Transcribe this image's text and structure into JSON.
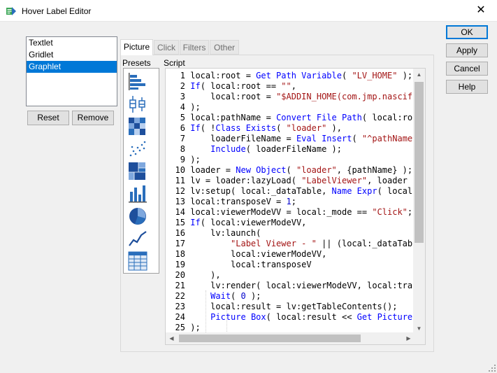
{
  "window": {
    "title": "Hover Label Editor"
  },
  "list": {
    "items": [
      {
        "label": "Textlet",
        "selected": false
      },
      {
        "label": "Gridlet",
        "selected": false
      },
      {
        "label": "Graphlet",
        "selected": true
      }
    ]
  },
  "buttons": {
    "reset": "Reset",
    "remove": "Remove",
    "ok": "OK",
    "apply": "Apply",
    "cancel": "Cancel",
    "help": "Help"
  },
  "tabs": [
    "Picture",
    "Click",
    "Filters",
    "Other"
  ],
  "labels": {
    "presets": "Presets",
    "script": "Script"
  },
  "presets": [
    "horizontal-bar-chart-icon",
    "box-plot-icon",
    "heat-map-icon",
    "scatter-plot-icon",
    "treemap-icon",
    "bar-chart-icon",
    "pie-chart-icon",
    "line-chart-icon",
    "table-icon"
  ],
  "colors": {
    "selection": "#0078d7",
    "keyword": "#0000ff",
    "string": "#a31515",
    "icon_blue": "#2a6ebb"
  },
  "script": {
    "lines": [
      {
        "n": "1",
        "parts": [
          {
            "t": "local:root = ",
            "c": "code"
          },
          {
            "t": "Get Path Variable",
            "c": "kw"
          },
          {
            "t": "( ",
            "c": "code"
          },
          {
            "t": "\"LV_HOME\"",
            "c": "str"
          },
          {
            "t": " );",
            "c": "code"
          }
        ]
      },
      {
        "n": "2",
        "parts": [
          {
            "t": "If",
            "c": "kw"
          },
          {
            "t": "( local:root == ",
            "c": "code"
          },
          {
            "t": "\"\"",
            "c": "str"
          },
          {
            "t": ",",
            "c": "code"
          }
        ]
      },
      {
        "n": "3",
        "parts": [
          {
            "t": "    local:root = ",
            "c": "code"
          },
          {
            "t": "\"$ADDIN_HOME(com.jmp.nascif",
            "c": "str"
          }
        ]
      },
      {
        "n": "4",
        "parts": [
          {
            "t": ");",
            "c": "code"
          }
        ]
      },
      {
        "n": "5",
        "parts": [
          {
            "t": "local:pathName = ",
            "c": "code"
          },
          {
            "t": "Convert File Path",
            "c": "kw"
          },
          {
            "t": "( local:roo",
            "c": "code"
          }
        ]
      },
      {
        "n": "6",
        "parts": [
          {
            "t": "If",
            "c": "kw"
          },
          {
            "t": "( !",
            "c": "code"
          },
          {
            "t": "Class Exists",
            "c": "kw"
          },
          {
            "t": "( ",
            "c": "code"
          },
          {
            "t": "\"loader\"",
            "c": "str"
          },
          {
            "t": " ),",
            "c": "code"
          }
        ]
      },
      {
        "n": "7",
        "parts": [
          {
            "t": "    loaderFileName = ",
            "c": "code"
          },
          {
            "t": "Eval Insert",
            "c": "kw"
          },
          {
            "t": "( ",
            "c": "code"
          },
          {
            "t": "\"^pathName^",
            "c": "str"
          }
        ]
      },
      {
        "n": "8",
        "parts": [
          {
            "t": "    ",
            "c": "code"
          },
          {
            "t": "Include",
            "c": "kw"
          },
          {
            "t": "( loaderFileName );",
            "c": "code"
          }
        ]
      },
      {
        "n": "9",
        "parts": [
          {
            "t": ");",
            "c": "code"
          }
        ]
      },
      {
        "n": "10",
        "parts": [
          {
            "t": "loader = ",
            "c": "code"
          },
          {
            "t": "New Object",
            "c": "kw"
          },
          {
            "t": "( ",
            "c": "code"
          },
          {
            "t": "\"loader\"",
            "c": "str"
          },
          {
            "t": ", {pathName} );",
            "c": "code"
          }
        ]
      },
      {
        "n": "11",
        "parts": [
          {
            "t": "lv = loader:lazyLoad( ",
            "c": "code"
          },
          {
            "t": "\"LabelViewer\"",
            "c": "str"
          },
          {
            "t": ", loader )",
            "c": "code"
          }
        ]
      },
      {
        "n": "12",
        "parts": [
          {
            "t": "lv:setup( local:_dataTable, ",
            "c": "code"
          },
          {
            "t": "Name Expr",
            "c": "kw"
          },
          {
            "t": "( local:",
            "c": "code"
          }
        ]
      },
      {
        "n": "13",
        "parts": [
          {
            "t": "local:transposeV = ",
            "c": "code"
          },
          {
            "t": "1",
            "c": "num"
          },
          {
            "t": ";",
            "c": "code"
          }
        ]
      },
      {
        "n": "14",
        "parts": [
          {
            "t": "local:viewerModeVV = local:_mode == ",
            "c": "code"
          },
          {
            "t": "\"Click\"",
            "c": "str"
          },
          {
            "t": ";",
            "c": "code"
          }
        ]
      },
      {
        "n": "15",
        "parts": [
          {
            "t": "If",
            "c": "kw"
          },
          {
            "t": "( local:viewerModeVV,",
            "c": "code"
          }
        ]
      },
      {
        "n": "16",
        "parts": [
          {
            "t": "    lv:launch(",
            "c": "code"
          }
        ]
      },
      {
        "n": "17",
        "parts": [
          {
            "t": "        ",
            "c": "code"
          },
          {
            "t": "\"Label Viewer - \"",
            "c": "str"
          },
          {
            "t": " || (local:_dataTabl",
            "c": "code"
          }
        ]
      },
      {
        "n": "18",
        "parts": [
          {
            "t": "        local:viewerModeVV,",
            "c": "code"
          }
        ]
      },
      {
        "n": "19",
        "parts": [
          {
            "t": "        local:transposeV",
            "c": "code"
          }
        ]
      },
      {
        "n": "20",
        "parts": [
          {
            "t": "    ),",
            "c": "code"
          }
        ]
      },
      {
        "n": "21",
        "parts": [
          {
            "t": "    lv:render( local:viewerModeVV, local:tran",
            "c": "code"
          }
        ]
      },
      {
        "n": "22",
        "parts": [
          {
            "t": "    ",
            "c": "code"
          },
          {
            "t": "Wait",
            "c": "kw"
          },
          {
            "t": "( ",
            "c": "code"
          },
          {
            "t": "0",
            "c": "num"
          },
          {
            "t": " );",
            "c": "code"
          }
        ]
      },
      {
        "n": "23",
        "parts": [
          {
            "t": "    local:result = lv:getTableContents();",
            "c": "code"
          }
        ]
      },
      {
        "n": "24",
        "parts": [
          {
            "t": "    ",
            "c": "code"
          },
          {
            "t": "Picture Box",
            "c": "kw"
          },
          {
            "t": "( local:result << ",
            "c": "code"
          },
          {
            "t": "Get Picture",
            "c": "kw"
          }
        ]
      },
      {
        "n": "25",
        "parts": [
          {
            "t": ");",
            "c": "code"
          }
        ]
      }
    ]
  }
}
